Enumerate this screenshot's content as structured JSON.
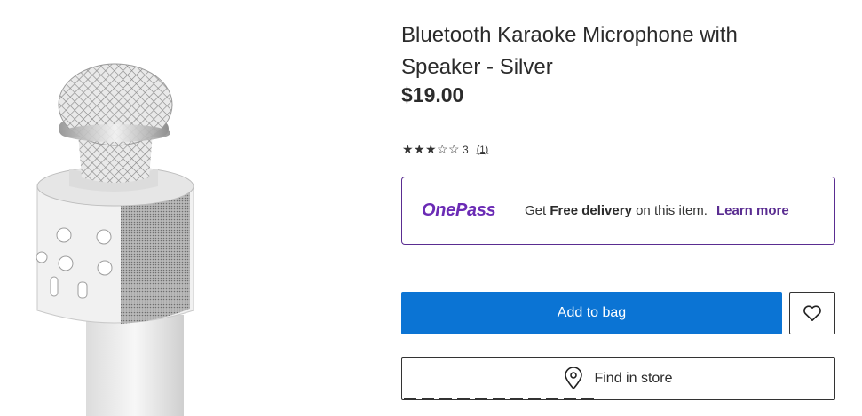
{
  "product": {
    "title": "Bluetooth Karaoke Microphone with Speaker - Silver",
    "price": "$19.00",
    "rating_value": "3",
    "review_count": "(1)",
    "stars": [
      "★",
      "★",
      "★",
      "☆",
      "☆"
    ]
  },
  "onepass": {
    "logo_text": "OnePass",
    "prefix": "Get ",
    "bold": "Free delivery",
    "suffix": " on this item.",
    "link": "Learn more"
  },
  "actions": {
    "add_to_bag": "Add to bag",
    "find_in_store": "Find in store"
  },
  "colors": {
    "primary_button": "#0b74d4",
    "onepass_purple": "#6b2bb5",
    "border": "#333333"
  },
  "icons": {
    "wishlist": "heart-icon",
    "store": "map-pin-icon"
  }
}
